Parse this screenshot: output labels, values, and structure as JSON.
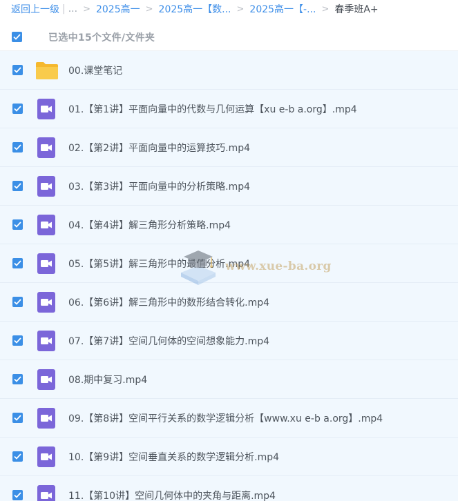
{
  "breadcrumb": {
    "back": "返回上一级",
    "sep": "|",
    "ellipsis": "...",
    "arrow": ">",
    "items": [
      "2025高一",
      "2025高一【数...",
      "2025高一【-..."
    ],
    "current": "春季班A+"
  },
  "selection": {
    "text": "已选中15个文件/文件夹",
    "checked": true
  },
  "files": [
    {
      "name": "00.课堂笔记",
      "type": "folder",
      "checked": true
    },
    {
      "name": "01.【第1讲】平面向量中的代数与几何运算【xu e-b a.org】.mp4",
      "type": "video",
      "checked": true
    },
    {
      "name": "02.【第2讲】平面向量中的运算技巧.mp4",
      "type": "video",
      "checked": true
    },
    {
      "name": "03.【第3讲】平面向量中的分析策略.mp4",
      "type": "video",
      "checked": true
    },
    {
      "name": "04.【第4讲】解三角形分析策略.mp4",
      "type": "video",
      "checked": true
    },
    {
      "name": "05.【第5讲】解三角形中的最值分析.mp4",
      "type": "video",
      "checked": true
    },
    {
      "name": "06.【第6讲】解三角形中的数形结合转化.mp4",
      "type": "video",
      "checked": true
    },
    {
      "name": "07.【第7讲】空间几何体的空间想象能力.mp4",
      "type": "video",
      "checked": true
    },
    {
      "name": "08.期中复习.mp4",
      "type": "video",
      "checked": true
    },
    {
      "name": "09.【第8讲】空间平行关系的数学逻辑分析【www.xu e-b a.org】.mp4",
      "type": "video",
      "checked": true
    },
    {
      "name": "10.【第9讲】空间垂直关系的数学逻辑分析.mp4",
      "type": "video",
      "checked": true
    },
    {
      "name": "11.【第10讲】空间几何体中的夹角与距离.mp4",
      "type": "video",
      "checked": true
    }
  ],
  "watermark": {
    "text": "www.xue-ba.org"
  },
  "colors": {
    "link": "#3d8ee8",
    "checkbox": "#3b8fe6",
    "row_bg": "#f1f8fe",
    "folder": "#f7c443",
    "video_icon": "#7b66d9"
  }
}
